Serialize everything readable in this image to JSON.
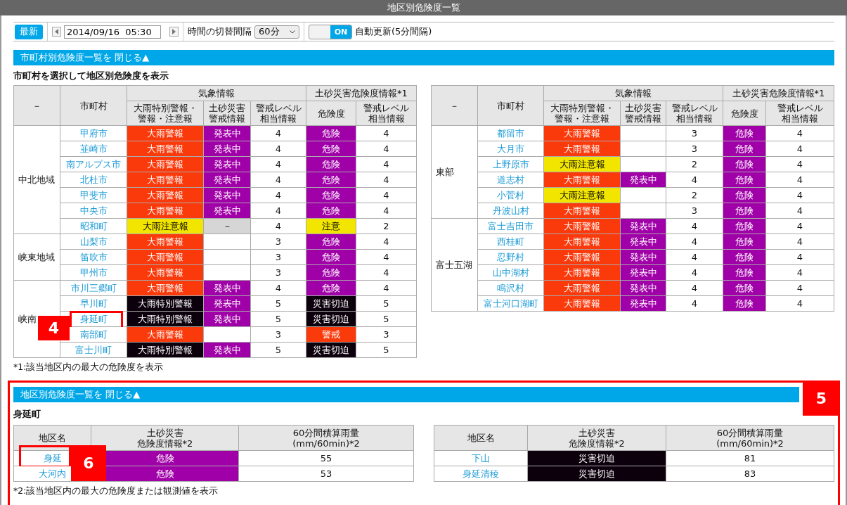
{
  "window": {
    "title": "地区別危険度一覧"
  },
  "toolbar": {
    "latest_button": "最新",
    "datetime": "2014/09/16  05:30",
    "interval_label": "時間の切替間隔",
    "interval": {
      "value": "60分"
    },
    "toggle": {
      "label": "ON",
      "on": true
    },
    "auto_update_label": "自動更新(5分間隔)"
  },
  "municipality_section": {
    "bar": "市町村別危険度一覧を 閉じる▲",
    "caption": "市町村を選択して地区別危険度を表示",
    "tables": [
      {
        "header": {
          "region": "－",
          "name": "市町村",
          "group_1": "気象情報",
          "group_2": "土砂災害危険度情報*1",
          "sub": [
            [
              "大雨特別警報・",
              "警報・注意報"
            ],
            [
              "土砂災害",
              "警戒情報"
            ],
            [
              "警戒レベル",
              "相当情報"
            ],
            [
              "危険度"
            ],
            [
              "警戒レベル",
              "相当情報"
            ]
          ]
        },
        "groups": [
          {
            "region": "中北地域",
            "rows": [
              {
                "name": "甲府市",
                "warning": {
                  "text": "大雨警報",
                  "kind": "warning"
                },
                "dosha": {
                  "text": "発表中",
                  "kind": "issued"
                },
                "level": "4",
                "danger": {
                  "text": "危険",
                  "kind": "danger"
                },
                "danger_level": "4"
              },
              {
                "name": "韮崎市",
                "warning": {
                  "text": "大雨警報",
                  "kind": "warning"
                },
                "dosha": {
                  "text": "発表中",
                  "kind": "issued"
                },
                "level": "4",
                "danger": {
                  "text": "危険",
                  "kind": "danger"
                },
                "danger_level": "4"
              },
              {
                "name": "南アルプス市",
                "warning": {
                  "text": "大雨警報",
                  "kind": "warning"
                },
                "dosha": {
                  "text": "発表中",
                  "kind": "issued"
                },
                "level": "4",
                "danger": {
                  "text": "危険",
                  "kind": "danger"
                },
                "danger_level": "4"
              },
              {
                "name": "北杜市",
                "warning": {
                  "text": "大雨警報",
                  "kind": "warning"
                },
                "dosha": {
                  "text": "発表中",
                  "kind": "issued"
                },
                "level": "4",
                "danger": {
                  "text": "危険",
                  "kind": "danger"
                },
                "danger_level": "4"
              },
              {
                "name": "甲斐市",
                "warning": {
                  "text": "大雨警報",
                  "kind": "warning"
                },
                "dosha": {
                  "text": "発表中",
                  "kind": "issued"
                },
                "level": "4",
                "danger": {
                  "text": "危険",
                  "kind": "danger"
                },
                "danger_level": "4"
              },
              {
                "name": "中央市",
                "warning": {
                  "text": "大雨警報",
                  "kind": "warning"
                },
                "dosha": {
                  "text": "発表中",
                  "kind": "issued"
                },
                "level": "4",
                "danger": {
                  "text": "危険",
                  "kind": "danger"
                },
                "danger_level": "4"
              },
              {
                "name": "昭和町",
                "warning": {
                  "text": "大雨注意報",
                  "kind": "advisory"
                },
                "dosha": {
                  "text": "－",
                  "kind": "na"
                },
                "level": "4",
                "danger": {
                  "text": "注意",
                  "kind": "caution"
                },
                "danger_level": "2"
              }
            ]
          },
          {
            "region": "峡東地域",
            "rows": [
              {
                "name": "山梨市",
                "warning": {
                  "text": "大雨警報",
                  "kind": "warning"
                },
                "dosha": {
                  "kind": "empty"
                },
                "level": "3",
                "danger": {
                  "text": "危険",
                  "kind": "danger"
                },
                "danger_level": "4"
              },
              {
                "name": "笛吹市",
                "warning": {
                  "text": "大雨警報",
                  "kind": "warning"
                },
                "dosha": {
                  "kind": "empty"
                },
                "level": "3",
                "danger": {
                  "text": "危険",
                  "kind": "danger"
                },
                "danger_level": "4"
              },
              {
                "name": "甲州市",
                "warning": {
                  "text": "大雨警報",
                  "kind": "warning"
                },
                "dosha": {
                  "kind": "empty"
                },
                "level": "3",
                "danger": {
                  "text": "危険",
                  "kind": "danger"
                },
                "danger_level": "4"
              }
            ]
          },
          {
            "region": "峡南",
            "rows": [
              {
                "name": "市川三郷町",
                "warning": {
                  "text": "大雨警報",
                  "kind": "warning"
                },
                "dosha": {
                  "text": "発表中",
                  "kind": "issued"
                },
                "level": "4",
                "danger": {
                  "text": "危険",
                  "kind": "danger"
                },
                "danger_level": "4"
              },
              {
                "name": "早川町",
                "warning": {
                  "text": "大雨特別警報",
                  "kind": "special"
                },
                "dosha": {
                  "text": "発表中",
                  "kind": "issued"
                },
                "level": "5",
                "danger": {
                  "text": "災害切迫",
                  "kind": "imminent"
                },
                "danger_level": "5"
              },
              {
                "name": "身延町",
                "callout": "4",
                "warning": {
                  "text": "大雨特別警報",
                  "kind": "special"
                },
                "dosha": {
                  "text": "発表中",
                  "kind": "issued"
                },
                "level": "5",
                "danger": {
                  "text": "災害切迫",
                  "kind": "imminent"
                },
                "danger_level": "5"
              },
              {
                "name": "南部町",
                "warning": {
                  "text": "大雨警報",
                  "kind": "warning"
                },
                "dosha": {
                  "kind": "empty"
                },
                "level": "3",
                "danger": {
                  "text": "警戒",
                  "kind": "alert"
                },
                "danger_level": "3"
              },
              {
                "name": "富士川町",
                "warning": {
                  "text": "大雨特別警報",
                  "kind": "special"
                },
                "dosha": {
                  "text": "発表中",
                  "kind": "issued"
                },
                "level": "5",
                "danger": {
                  "text": "災害切迫",
                  "kind": "imminent"
                },
                "danger_level": "5"
              }
            ]
          }
        ]
      },
      {
        "header": {
          "region": "－",
          "name": "市町村",
          "group_1": "気象情報",
          "group_2": "土砂災害危険度情報*1",
          "sub": [
            [
              "大雨特別警報・",
              "警報・注意報"
            ],
            [
              "土砂災害",
              "警戒情報"
            ],
            [
              "警戒レベル",
              "相当情報"
            ],
            [
              "危険度"
            ],
            [
              "警戒レベル",
              "相当情報"
            ]
          ]
        },
        "groups": [
          {
            "region": "東部",
            "rows": [
              {
                "name": "都留市",
                "warning": {
                  "text": "大雨警報",
                  "kind": "warning"
                },
                "dosha": {
                  "kind": "empty"
                },
                "level": "3",
                "danger": {
                  "text": "危険",
                  "kind": "danger"
                },
                "danger_level": "4"
              },
              {
                "name": "大月市",
                "warning": {
                  "text": "大雨警報",
                  "kind": "warning"
                },
                "dosha": {
                  "kind": "empty"
                },
                "level": "3",
                "danger": {
                  "text": "危険",
                  "kind": "danger"
                },
                "danger_level": "4"
              },
              {
                "name": "上野原市",
                "warning": {
                  "text": "大雨注意報",
                  "kind": "advisory"
                },
                "dosha": {
                  "kind": "empty"
                },
                "level": "2",
                "danger": {
                  "text": "危険",
                  "kind": "danger"
                },
                "danger_level": "4"
              },
              {
                "name": "道志村",
                "warning": {
                  "text": "大雨警報",
                  "kind": "warning"
                },
                "dosha": {
                  "text": "発表中",
                  "kind": "issued"
                },
                "level": "4",
                "danger": {
                  "text": "危険",
                  "kind": "danger"
                },
                "danger_level": "4"
              },
              {
                "name": "小菅村",
                "warning": {
                  "text": "大雨注意報",
                  "kind": "advisory"
                },
                "dosha": {
                  "kind": "empty"
                },
                "level": "2",
                "danger": {
                  "text": "危険",
                  "kind": "danger"
                },
                "danger_level": "4"
              },
              {
                "name": "丹波山村",
                "warning": {
                  "text": "大雨警報",
                  "kind": "warning"
                },
                "dosha": {
                  "kind": "empty"
                },
                "level": "3",
                "danger": {
                  "text": "危険",
                  "kind": "danger"
                },
                "danger_level": "4"
              }
            ]
          },
          {
            "region": "富士五湖",
            "rows": [
              {
                "name": "富士吉田市",
                "warning": {
                  "text": "大雨警報",
                  "kind": "warning"
                },
                "dosha": {
                  "text": "発表中",
                  "kind": "issued"
                },
                "level": "4",
                "danger": {
                  "text": "危険",
                  "kind": "danger"
                },
                "danger_level": "4"
              },
              {
                "name": "西桂町",
                "warning": {
                  "text": "大雨警報",
                  "kind": "warning"
                },
                "dosha": {
                  "text": "発表中",
                  "kind": "issued"
                },
                "level": "4",
                "danger": {
                  "text": "危険",
                  "kind": "danger"
                },
                "danger_level": "4"
              },
              {
                "name": "忍野村",
                "warning": {
                  "text": "大雨警報",
                  "kind": "warning"
                },
                "dosha": {
                  "text": "発表中",
                  "kind": "issued"
                },
                "level": "4",
                "danger": {
                  "text": "危険",
                  "kind": "danger"
                },
                "danger_level": "4"
              },
              {
                "name": "山中湖村",
                "warning": {
                  "text": "大雨警報",
                  "kind": "warning"
                },
                "dosha": {
                  "text": "発表中",
                  "kind": "issued"
                },
                "level": "4",
                "danger": {
                  "text": "危険",
                  "kind": "danger"
                },
                "danger_level": "4"
              },
              {
                "name": "鳴沢村",
                "warning": {
                  "text": "大雨警報",
                  "kind": "warning"
                },
                "dosha": {
                  "text": "発表中",
                  "kind": "issued"
                },
                "level": "4",
                "danger": {
                  "text": "危険",
                  "kind": "danger"
                },
                "danger_level": "4"
              },
              {
                "name": "富士河口湖町",
                "warning": {
                  "text": "大雨警報",
                  "kind": "warning"
                },
                "dosha": {
                  "text": "発表中",
                  "kind": "issued"
                },
                "level": "4",
                "danger": {
                  "text": "危険",
                  "kind": "danger"
                },
                "danger_level": "4"
              }
            ]
          }
        ]
      }
    ],
    "footnote": "*1:該当地区内の最大の危険度を表示"
  },
  "district_section": {
    "callout": "5",
    "bar": "地区別危険度一覧を 閉じる▲",
    "caption": "身延町",
    "tables": [
      {
        "header": [
          [
            "地区名"
          ],
          [
            "土砂災害",
            "危険度情報*2"
          ],
          [
            "60分間積算雨量",
            "(mm/60min)*2"
          ]
        ],
        "rows": [
          {
            "name": "身延",
            "callout": "6",
            "danger": {
              "text": "危険",
              "kind": "danger"
            },
            "rain": "55"
          },
          {
            "name": "大河内",
            "danger": {
              "text": "危険",
              "kind": "danger"
            },
            "rain": "53"
          }
        ]
      },
      {
        "header": [
          [
            "地区名"
          ],
          [
            "土砂災害",
            "危険度情報*2"
          ],
          [
            "60分間積算雨量",
            "(mm/60min)*2"
          ]
        ],
        "rows": [
          {
            "name": "下山",
            "danger": {
              "text": "災害切迫",
              "kind": "imminent"
            },
            "rain": "81"
          },
          {
            "name": "身延清稜",
            "danger": {
              "text": "災害切迫",
              "kind": "imminent"
            },
            "rain": "83"
          }
        ]
      }
    ],
    "footnote": "*2:該当地区内の最大の危険度または観測値を表示"
  }
}
